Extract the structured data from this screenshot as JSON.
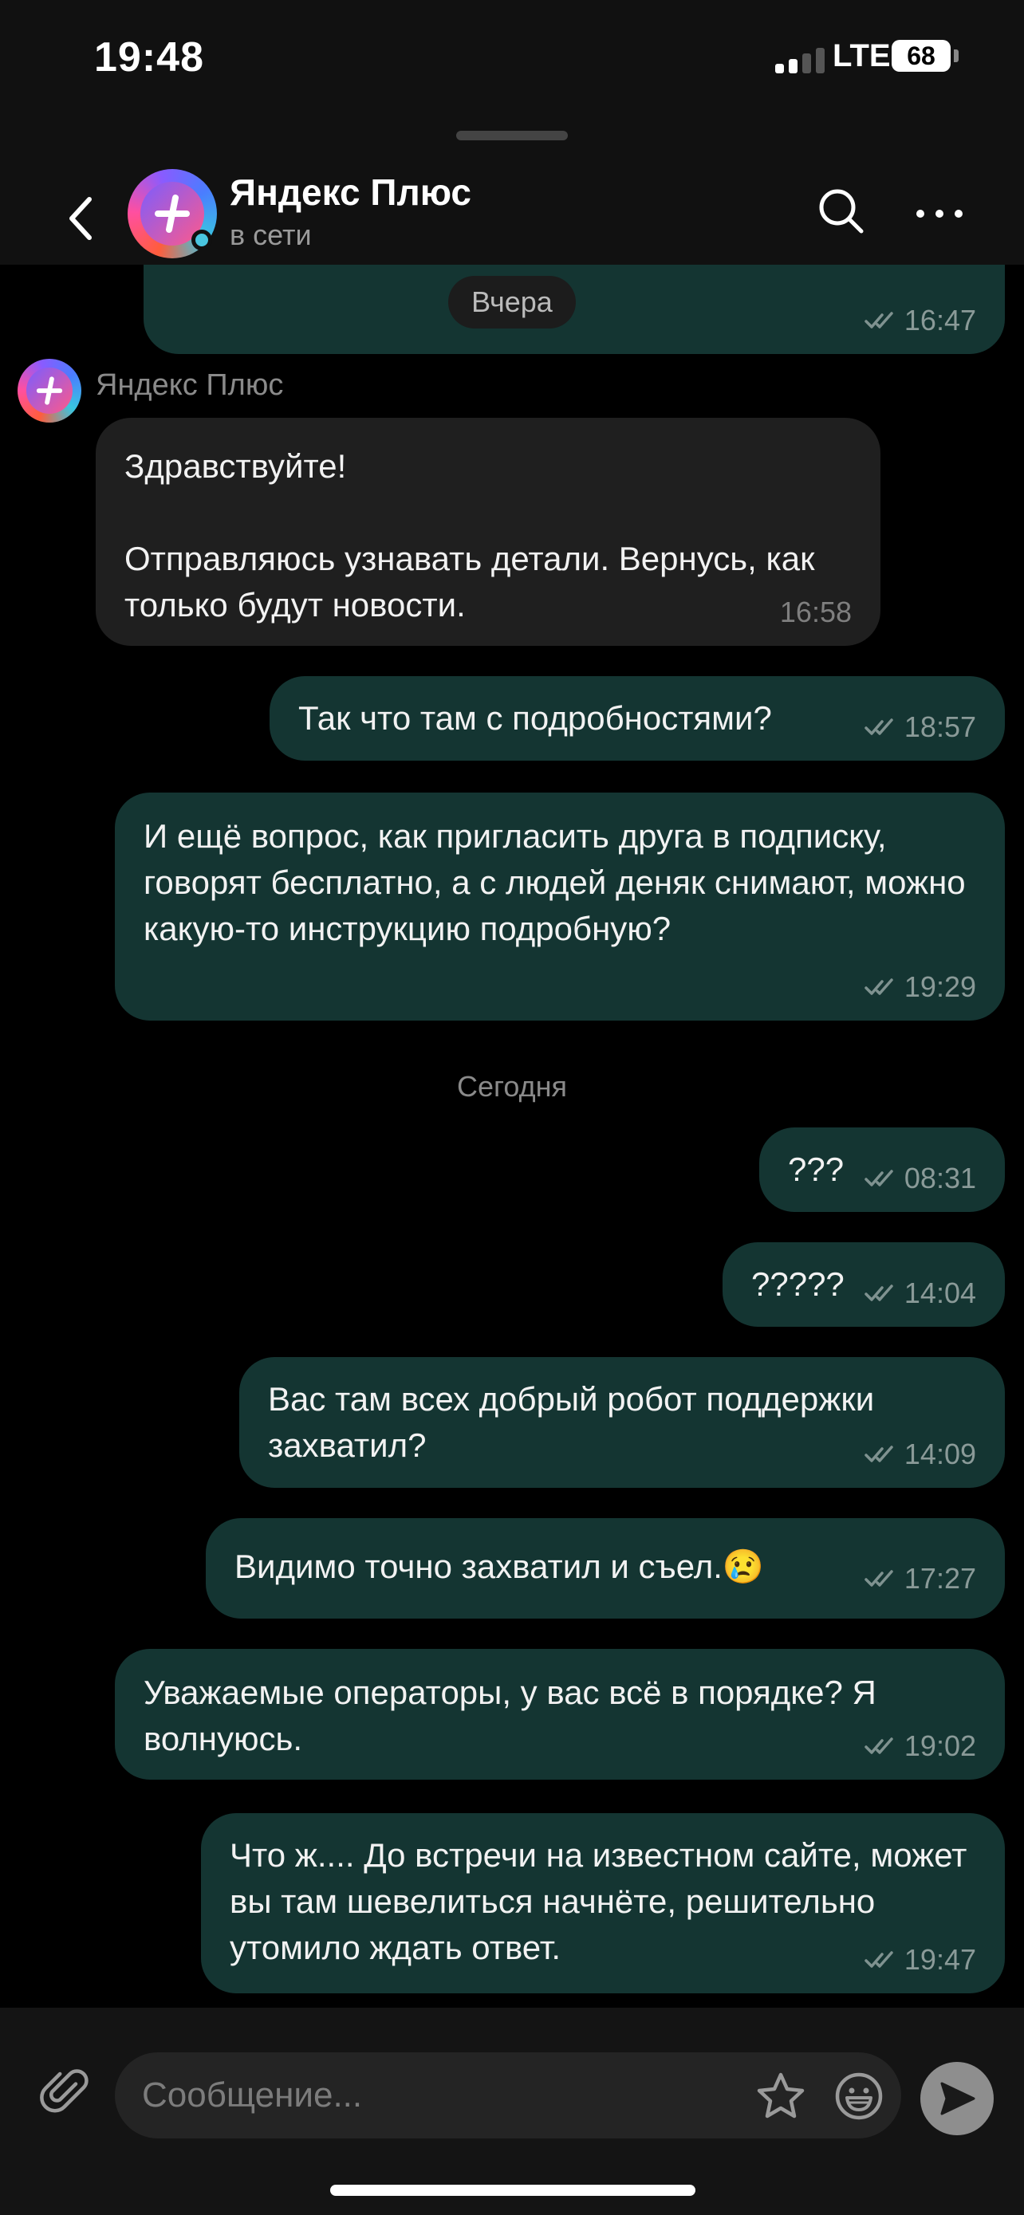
{
  "status_bar": {
    "time": "19:48",
    "network": "LTE",
    "battery": "68"
  },
  "header": {
    "contact_name": "Яндекс Плюс",
    "contact_status": "в сети",
    "back_icon": "chevron-left-icon",
    "search_icon": "search-icon",
    "more_icon": "more-horizontal-icon"
  },
  "chat": {
    "top_partial_time": "16:47",
    "date_yesterday": "Вчера",
    "sender_name": "Яндекс Плюс",
    "date_today": "Сегодня",
    "messages": [
      {
        "direction": "in",
        "text": "Здравствуйте!\n\nОтправляюсь узнавать детали. Вернусь, как только будут новости.",
        "time": "16:58"
      },
      {
        "direction": "out",
        "text": "Так что там с подробностями?",
        "time": "18:57",
        "status": "read"
      },
      {
        "direction": "out",
        "text": "И ещё вопрос, как пригласить друга в подписку, говорят бесплатно, а с людей деняк снимают, можно какую-то инструкцию подробную?",
        "time": "19:29",
        "status": "read"
      },
      {
        "direction": "out",
        "text": "???",
        "time": "08:31",
        "status": "read"
      },
      {
        "direction": "out",
        "text": "?????",
        "time": "14:04",
        "status": "read"
      },
      {
        "direction": "out",
        "text": "Вас там всех добрый робот поддержки захватил?",
        "time": "14:09",
        "status": "read"
      },
      {
        "direction": "out",
        "text": "Видимо точно захватил и съел.😢",
        "time": "17:27",
        "status": "read"
      },
      {
        "direction": "out",
        "text": "Уважаемые операторы, у вас всё в порядке? Я волнуюсь.",
        "time": "19:02",
        "status": "read"
      },
      {
        "direction": "out",
        "text": "Что ж.... До встречи на известном сайте, может вы там шевелиться начнёте, решительно утомило ждать ответ.",
        "time": "19:47",
        "status": "read"
      }
    ]
  },
  "input_bar": {
    "placeholder": "Сообщение...",
    "attach_icon": "paperclip-icon",
    "star_icon": "star-icon",
    "emoji_icon": "smiley-icon",
    "send_icon": "send-icon"
  },
  "colors": {
    "background": "#000000",
    "header_bg": "#111111",
    "outgoing_bubble": "#143532",
    "incoming_bubble": "#1f1f1f",
    "online_dot": "#4ac6e0"
  }
}
